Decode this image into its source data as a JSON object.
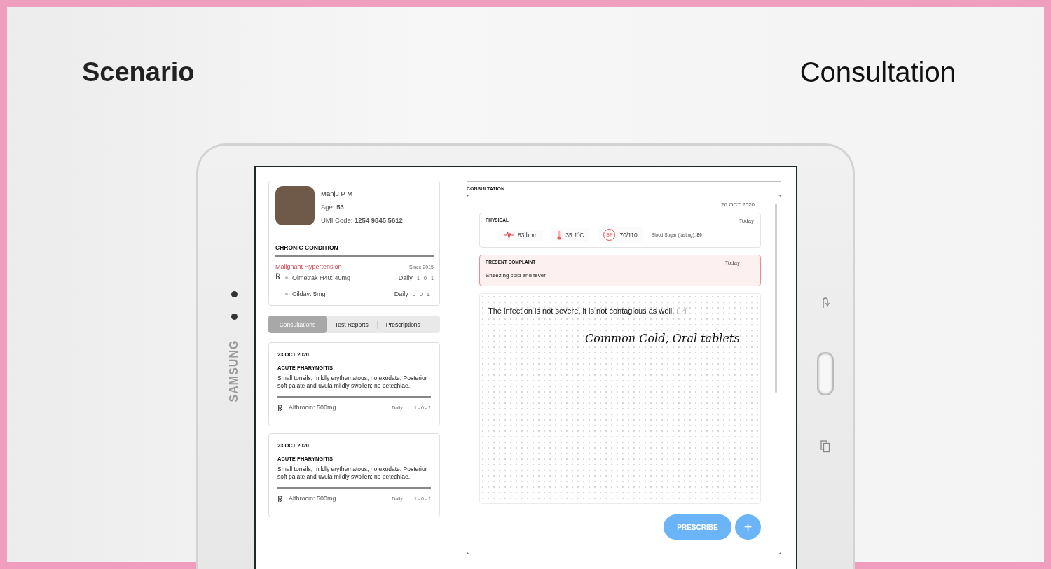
{
  "slide": {
    "heading": "Scenario",
    "title": "Consultation"
  },
  "device": {
    "brand": "SAMSUNG"
  },
  "patient": {
    "name": "Manju P M",
    "age": "Age: **53**",
    "umi": "UMI Code: **1254 9845 5612**"
  },
  "chronic": {
    "title": "CHRONIC CONDITION",
    "condition": "Malignant Hypertension",
    "since": "Since 2015",
    "rx": "℞",
    "medications": [
      {
        "name": "Olmetrak H40: 40mg",
        "frequency": "Daily",
        "dosage": "1 - 0 - 1"
      },
      {
        "name": "Cilday: 5mg",
        "frequency": "Daily",
        "dosage": "0 - 0 - 1"
      }
    ]
  },
  "tabs": [
    {
      "label": "Consultations",
      "selected": true
    },
    {
      "label": "Test Reports",
      "selected": false
    },
    {
      "label": "Prescriptions",
      "selected": false
    }
  ],
  "consultations": [
    {
      "date": "23 OCT 2020",
      "diagnosis": "ACUTE PHARYNGITIS",
      "notes": "Small tonsils; mildly erythematous; no exudate. Posterior soft palate and uvula mildly swollen; no petechiae.",
      "rx": "℞",
      "medication": "Althrocin: 500mg",
      "frequency": "Daily",
      "dosage": "1 - 0 - 1"
    },
    {
      "date": "23 OCT 2020",
      "diagnosis": "ACUTE PHARYNGITIS",
      "notes": "Small tonsils; mildly erythematous; no exudate. Posterior soft palate and uvula mildly swollen; no petechiae.",
      "rx": "℞",
      "medication": "Althrocin: 500mg",
      "frequency": "Daily",
      "dosage": "1 - 0 - 1"
    }
  ],
  "consultation": {
    "section_label": "CONSULTATION",
    "date": "26 OCT 2020",
    "physical": {
      "title": "PHYSICAL",
      "when": "Today",
      "pulse": "83 bpm",
      "temperature": "35.1°C",
      "bp_badge": "BP",
      "bp": "70/110",
      "sugar": "Blood Sugar (fasting): **80**"
    },
    "complaint": {
      "title": "PRESENT COMPLAINT",
      "when": "Today",
      "text": "Sneezing cold and fever"
    },
    "notes": {
      "typed": "The infection is not severe, it is not contagious as well.",
      "handwriting": "Common Cold, Oral tablets"
    },
    "actions": {
      "prescribe": "PRESCRIBE",
      "add": "+"
    }
  }
}
